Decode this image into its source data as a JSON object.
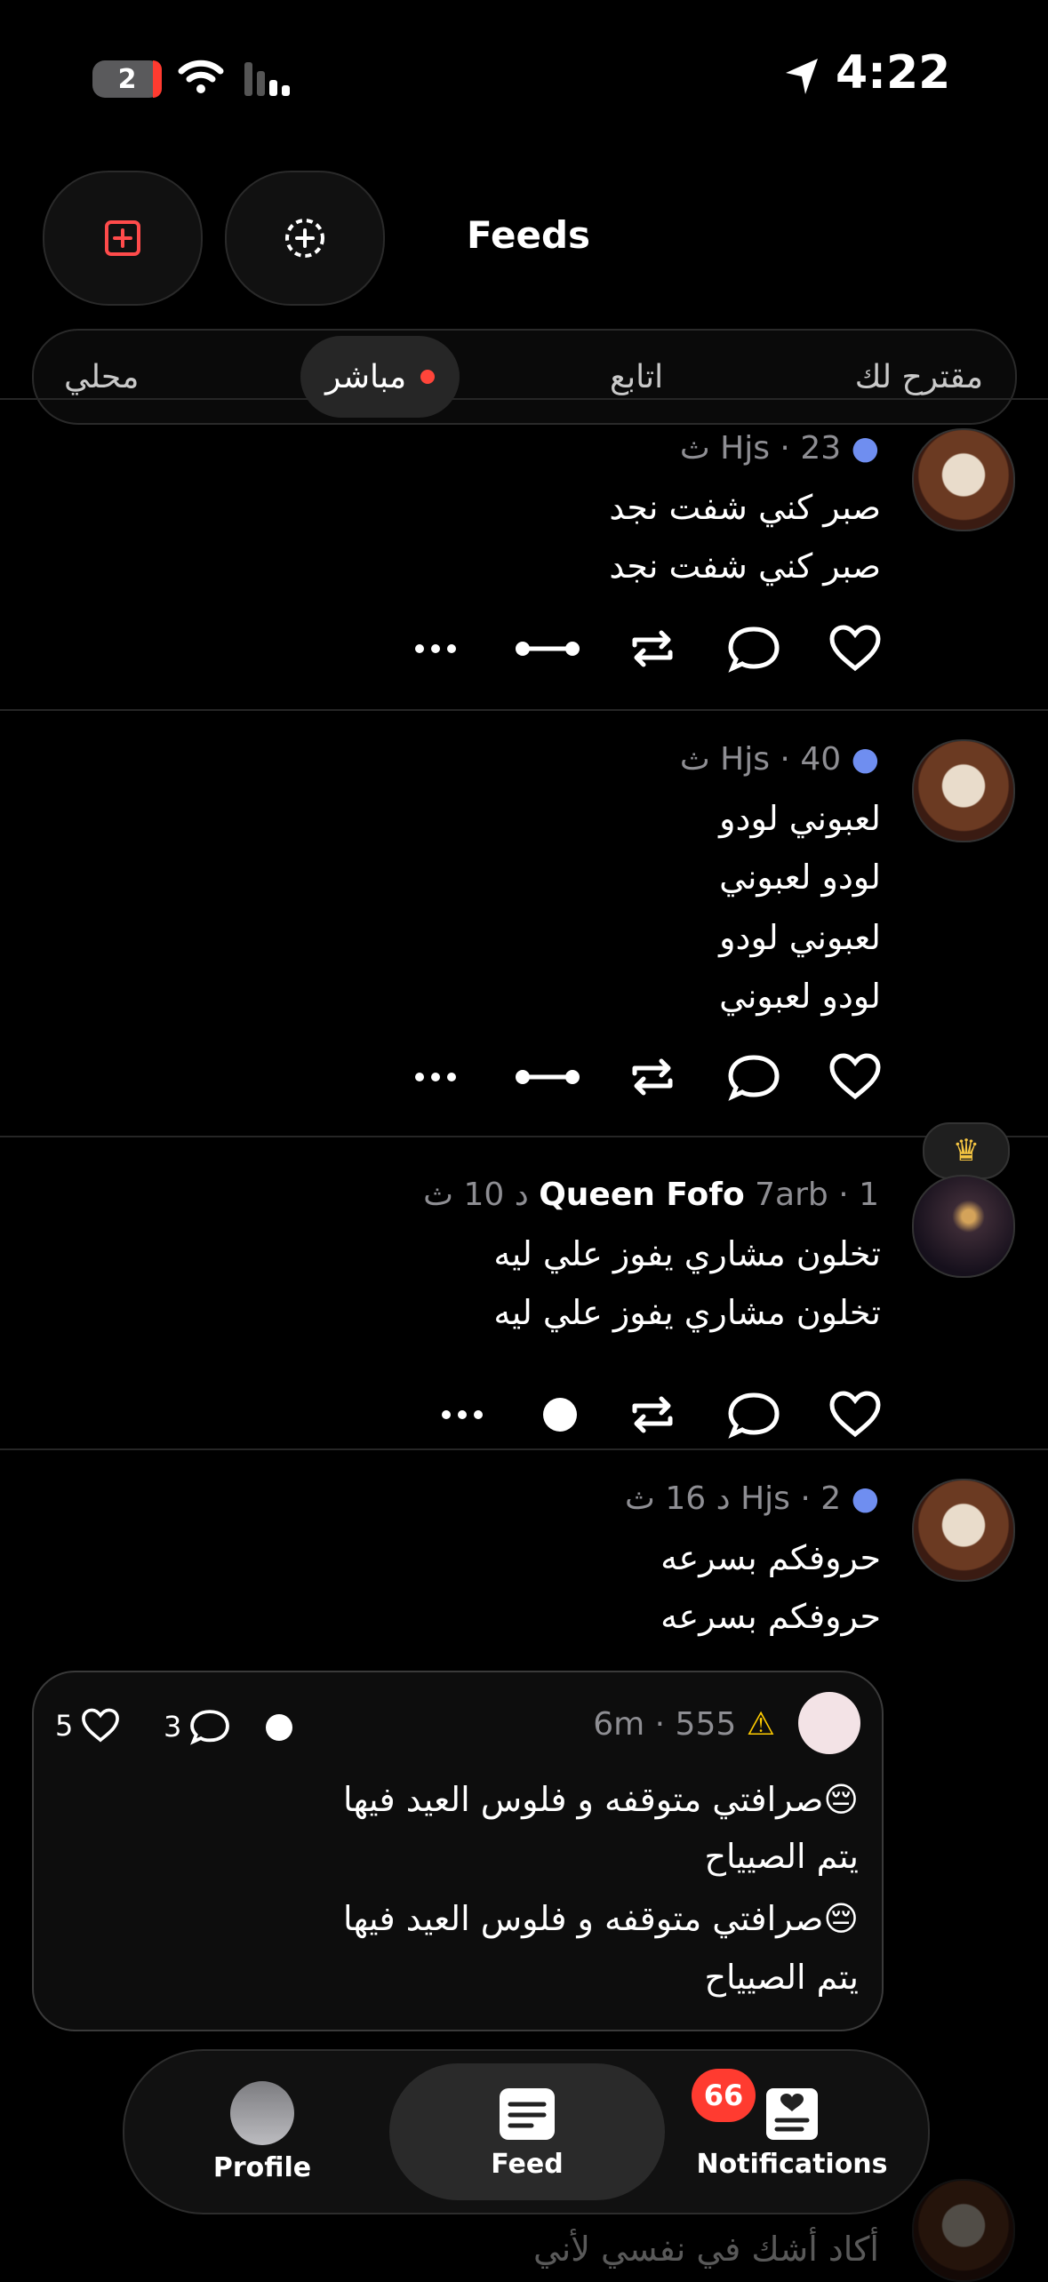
{
  "status_bar": {
    "time": "4:22",
    "sim_badge": "2"
  },
  "header": {
    "title": "Feeds",
    "add_button_icon": "plus-square-icon",
    "compose_button_icon": "add-circle-icon"
  },
  "tabs": [
    {
      "label": "مقترح لك",
      "active": false
    },
    {
      "label": "اتابع",
      "active": false
    },
    {
      "label": "مباشر",
      "active": true,
      "live": true
    },
    {
      "label": "محلي",
      "active": false
    }
  ],
  "posts": [
    {
      "author": "Hjs",
      "meta": "Hjs · 23 ث",
      "lines": [
        "صبر كني شفت نجد",
        "صبر كني شفت نجد"
      ]
    },
    {
      "author": "Hjs",
      "meta": "Hjs · 40 ث",
      "lines": [
        "لعبوني لودو",
        "لودو لعبوني",
        "لعبوني لودو",
        "لودو لعبوني"
      ]
    },
    {
      "author": "Queen Fofo",
      "handle": "7arb",
      "meta_prefix": "7arb · 1 د 10 ث",
      "lines": [
        "تخلون مشاري يفوز علي ليه",
        "تخلون مشاري يفوز علي ليه"
      ]
    },
    {
      "author": "Hjs",
      "meta": "Hjs · 2 د 16 ث",
      "lines": [
        "حروفكم بسرعه",
        "حروفكم بسرعه"
      ]
    }
  ],
  "quote": {
    "author": "555",
    "time": "6m",
    "likes": "5",
    "comments": "3",
    "lines": [
      "😔صرافتي متوقفه و فلوس العيد فيها",
      "يتم الصيياح",
      "😔صرافتي متوقفه و فلوس العيد فيها",
      "يتم الصيياح"
    ]
  },
  "faded_post_line": "أكاد أشك في نفسي لأني",
  "bottom_nav": {
    "items": [
      {
        "label": "Profile"
      },
      {
        "label": "Feed",
        "active": true
      },
      {
        "label": "Notifications",
        "badge": "66"
      }
    ]
  }
}
